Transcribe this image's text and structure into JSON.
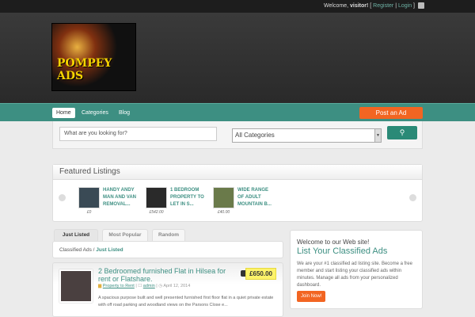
{
  "topbar": {
    "welcome": "Welcome, ",
    "user": "visitor!",
    "open": " [ ",
    "register": "Register",
    "sep": " | ",
    "login": "Login",
    "close": " ]"
  },
  "logo": {
    "text": "POMPEY ADS"
  },
  "nav": {
    "items": [
      "Home",
      "Categories",
      "Blog"
    ],
    "post_ad": "Post an Ad"
  },
  "search": {
    "placeholder": "What are you looking for?",
    "category": "All Categories"
  },
  "featured": {
    "title": "Featured Listings",
    "items": [
      {
        "title": "HANDY ANDY MAN AND VAN REMOVAL...",
        "price": "£0"
      },
      {
        "title": "1 BEDROOM PROPERTY TO LET IN S...",
        "price": "£542.00"
      },
      {
        "title": "WIDE RANGE OF ADULT MOUNTAIN B...",
        "price": "£40.00"
      }
    ]
  },
  "tabs": [
    "Just Listed",
    "Most Popular",
    "Random"
  ],
  "breadcrumb": {
    "root": "Classified Ads",
    "sep": " / ",
    "current": "Just Listed"
  },
  "listing": {
    "title": "2 Bedroomed furnished Flat in Hilsea for rent or Flatshare.",
    "price": "£650.00",
    "category": "Property to Rent",
    "author": "admin",
    "date": "April 12, 2014",
    "description": "A spacious purpose built and well presented furnished first floor flat in a quiet private estate with off road parking and woodland views on the Parsons Close e..."
  },
  "sidebar": {
    "heading": "Welcome to our Web site!",
    "title": "List Your Classified Ads",
    "text": "We are your #1 classified ad listing site. Become a free member and start listing your classified ads within minutes. Manage all ads from your personalized dashboard.",
    "button": "Join Now!"
  }
}
